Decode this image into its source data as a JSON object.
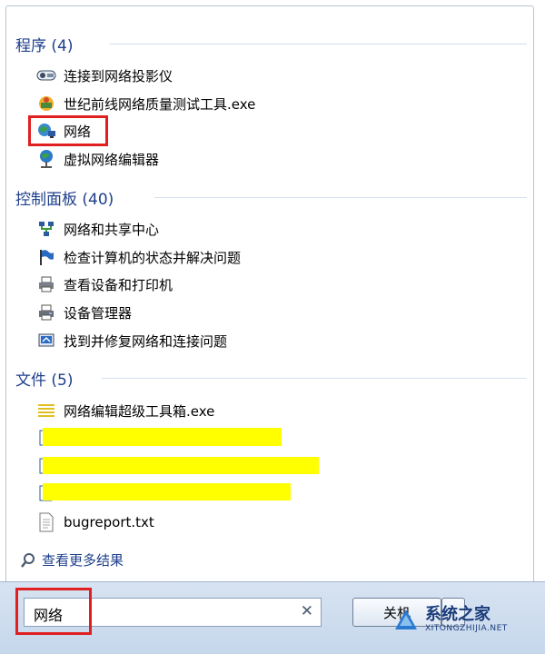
{
  "sections": [
    {
      "header": "程序 (4)",
      "items": [
        {
          "label": "连接到网络投影仪",
          "icon": "projector-icon"
        },
        {
          "label": "世纪前线网络质量测试工具.exe",
          "icon": "app-exe-icon"
        },
        {
          "label": "网络",
          "icon": "network-globe-icon"
        },
        {
          "label": "虚拟网络编辑器",
          "icon": "virtual-network-icon"
        }
      ]
    },
    {
      "header": "控制面板 (40)",
      "items": [
        {
          "label": "网络和共享中心",
          "icon": "network-sharing-icon"
        },
        {
          "label": "检查计算机的状态并解决问题",
          "icon": "action-center-flag-icon"
        },
        {
          "label": "查看设备和打印机",
          "icon": "printer-icon"
        },
        {
          "label": "设备管理器",
          "icon": "device-manager-icon"
        },
        {
          "label": "找到并修复网络和连接问题",
          "icon": "troubleshoot-icon"
        }
      ]
    },
    {
      "header": "文件 (5)",
      "items": [
        {
          "label": "网络编辑超级工具箱.exe",
          "icon": "exe-file-icon"
        },
        {
          "label": "",
          "icon": "file-icon"
        },
        {
          "label": "",
          "icon": "file-icon"
        },
        {
          "label": "",
          "icon": "file-icon"
        },
        {
          "label": "bugreport.txt",
          "icon": "text-file-icon"
        }
      ]
    }
  ],
  "more_results": "查看更多结果",
  "search": {
    "value": "网络"
  },
  "shutdown_label": "关机",
  "watermark": {
    "title": "系统之家",
    "subtitle": "XITONGZHIJIA.NET"
  },
  "colors": {
    "header": "#1e3f8c",
    "highlight_box": "#e02020",
    "redaction": "#ffff00"
  }
}
